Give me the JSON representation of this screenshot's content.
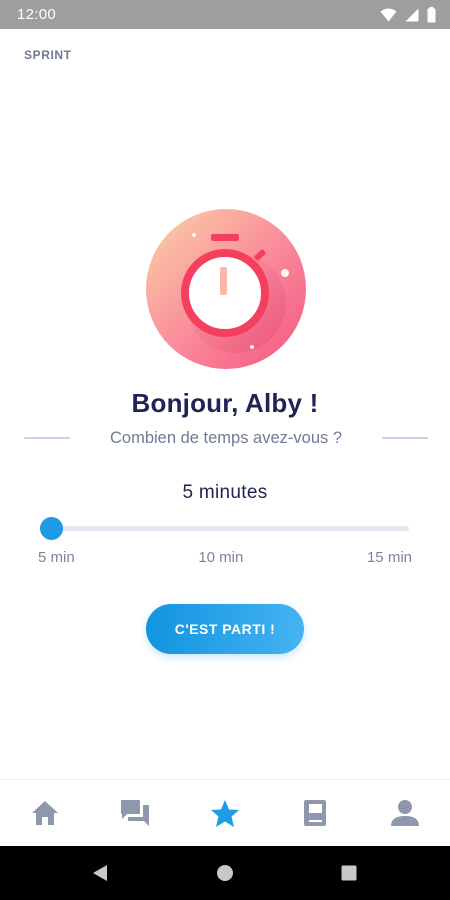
{
  "status_bar": {
    "time": "12:00"
  },
  "screen": {
    "label": "SPRINT"
  },
  "main": {
    "greeting": "Bonjour, Alby !",
    "question": "Combien de temps avez-vous ?",
    "duration_value": "5 minutes",
    "slider": {
      "value": 5,
      "min": 5,
      "max": 15,
      "tick_labels": [
        "5 min",
        "10 min",
        "15 min"
      ]
    },
    "cta_label": "C'EST PARTI !"
  },
  "bottom_nav": {
    "items": [
      {
        "icon": "home-icon",
        "active": false
      },
      {
        "icon": "chat-icon",
        "active": false
      },
      {
        "icon": "star-icon",
        "active": true
      },
      {
        "icon": "book-icon",
        "active": false
      },
      {
        "icon": "profile-icon",
        "active": false
      }
    ]
  },
  "colors": {
    "accent": "#1f9be6",
    "title": "#1f2455",
    "muted": "#6f7a94",
    "nav_inactive": "#8e97ab",
    "timer_red": "#f43f5e"
  }
}
